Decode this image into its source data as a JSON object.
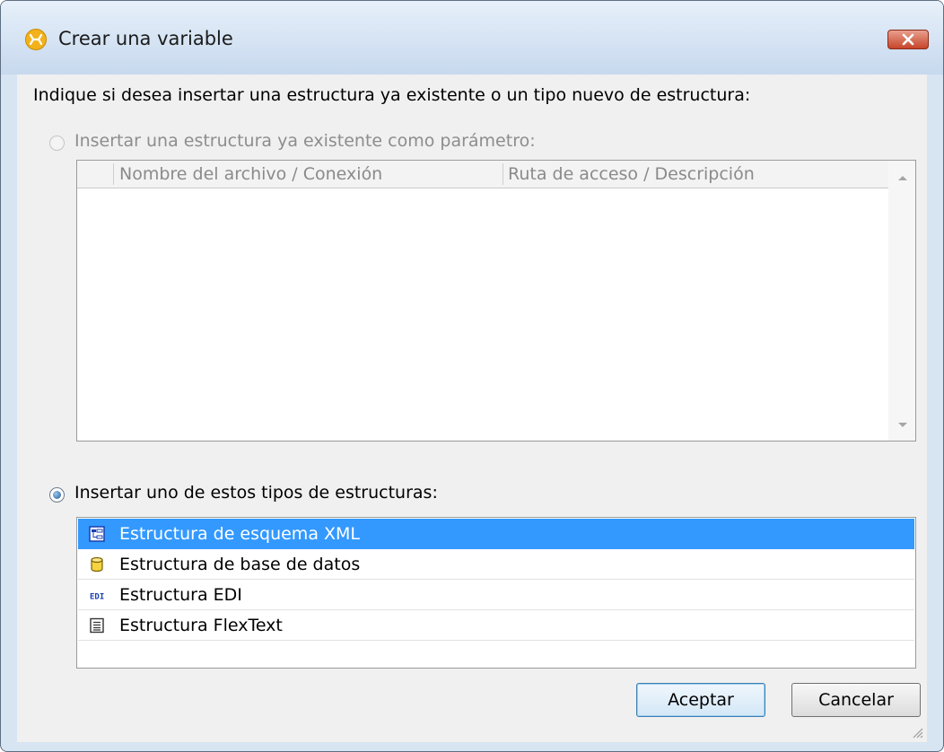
{
  "window": {
    "title": "Crear una variable",
    "close_icon": "close-icon",
    "app_icon": "mapforce-app-icon"
  },
  "prompt": "Indique si desea insertar una estructura ya existente o un tipo nuevo de estructura:",
  "option_existing": {
    "label": "Insertar una estructura ya existente como parámetro:",
    "checked": false,
    "enabled": false
  },
  "existing_table": {
    "columns": [
      "Nombre del archivo / Conexión",
      "Ruta de acceso / Descripción"
    ],
    "rows": []
  },
  "option_new": {
    "label": "Insertar uno de estos tipos de estructuras:",
    "checked": true
  },
  "structure_types": [
    {
      "label": "Estructura de esquema XML",
      "icon": "xml-schema-icon",
      "selected": true
    },
    {
      "label": "Estructura de base de datos",
      "icon": "database-icon",
      "selected": false
    },
    {
      "label": "Estructura EDI",
      "icon": "edi-icon",
      "icon_text": "EDI",
      "selected": false
    },
    {
      "label": "Estructura FlexText",
      "icon": "flextext-icon",
      "selected": false
    }
  ],
  "buttons": {
    "ok": "Aceptar",
    "cancel": "Cancelar"
  },
  "colors": {
    "selection": "#3399ff",
    "close_button": "#c74529",
    "app_icon": "#f3b21b"
  }
}
